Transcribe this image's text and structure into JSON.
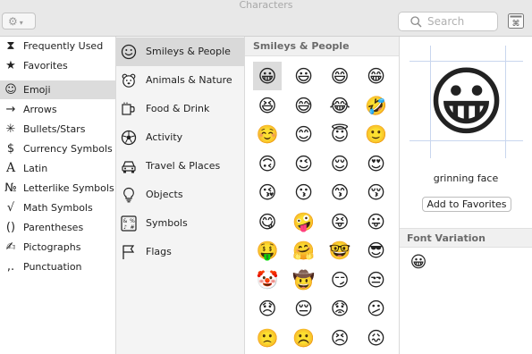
{
  "window": {
    "title": "Characters"
  },
  "toolbar": {
    "search_placeholder": "Search"
  },
  "sidebar": {
    "items": [
      {
        "label": "Frequently Used",
        "icon": "clock-icon",
        "glyph": "⧗",
        "selected": false
      },
      {
        "label": "Favorites",
        "icon": "star-icon",
        "glyph": "★",
        "selected": false
      },
      {
        "label": "Emoji",
        "icon": "smiley-icon",
        "glyph": "☺",
        "selected": true
      },
      {
        "label": "Arrows",
        "icon": "arrow-icon",
        "glyph": "→",
        "selected": false
      },
      {
        "label": "Bullets/Stars",
        "icon": "asterisk-icon",
        "glyph": "✳",
        "selected": false
      },
      {
        "label": "Currency Symbols",
        "icon": "dollar-icon",
        "glyph": "$",
        "selected": false
      },
      {
        "label": "Latin",
        "icon": "letter-a-icon",
        "glyph": "A",
        "selected": false
      },
      {
        "label": "Letterlike Symbols",
        "icon": "numero-icon",
        "glyph": "№",
        "selected": false
      },
      {
        "label": "Math Symbols",
        "icon": "square-root-icon",
        "glyph": "√",
        "selected": false
      },
      {
        "label": "Parentheses",
        "icon": "parentheses-icon",
        "glyph": "()",
        "selected": false
      },
      {
        "label": "Pictographs",
        "icon": "writing-hand-icon",
        "glyph": "✍",
        "selected": false
      },
      {
        "label": "Punctuation",
        "icon": "punctuation-icon",
        "glyph": ",.",
        "selected": false
      }
    ]
  },
  "categories": {
    "items": [
      {
        "label": "Smileys & People",
        "icon": "smiley-icon",
        "selected": true
      },
      {
        "label": "Animals & Nature",
        "icon": "bear-icon",
        "selected": false
      },
      {
        "label": "Food & Drink",
        "icon": "food-icon",
        "selected": false
      },
      {
        "label": "Activity",
        "icon": "soccer-ball-icon",
        "selected": false
      },
      {
        "label": "Travel & Places",
        "icon": "car-icon",
        "selected": false
      },
      {
        "label": "Objects",
        "icon": "lightbulb-icon",
        "selected": false
      },
      {
        "label": "Symbols",
        "icon": "symbols-icon",
        "selected": false
      },
      {
        "label": "Flags",
        "icon": "flag-icon",
        "selected": false
      }
    ]
  },
  "grid": {
    "header": "Smileys & People",
    "emojis": [
      "😀",
      "😃",
      "😄",
      "😁",
      "😆",
      "😅",
      "😂",
      "🤣",
      "☺️",
      "😊",
      "😇",
      "🙂",
      "🙃",
      "😉",
      "😌",
      "😍",
      "😘",
      "😗",
      "😙",
      "😚",
      "😋",
      "🤪",
      "😝",
      "😛",
      "🤑",
      "🤗",
      "🤓",
      "😎",
      "🤡",
      "🤠",
      "😏",
      "😒",
      "😞",
      "😔",
      "😟",
      "😕",
      "🙁",
      "☹️",
      "😣",
      "😖"
    ],
    "selected_index": 0
  },
  "detail": {
    "emoji": "😀",
    "name": "grinning face",
    "favorites_button": "Add to Favorites",
    "font_variation_header": "Font Variation",
    "variations": [
      "😀"
    ]
  }
}
